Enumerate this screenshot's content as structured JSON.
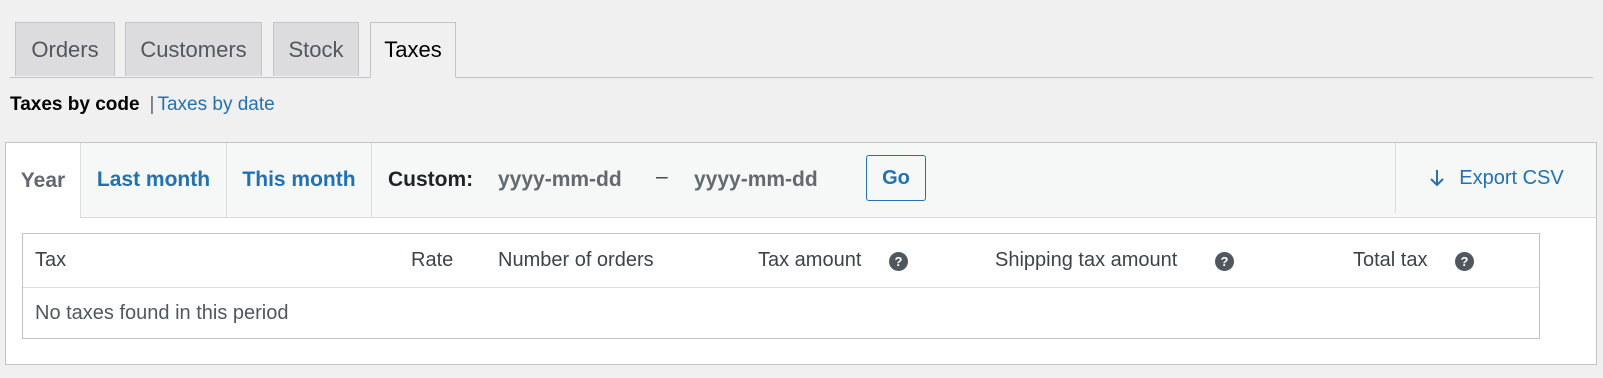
{
  "tabs": [
    "Orders",
    "Customers",
    "Stock",
    "Taxes"
  ],
  "active_tab": "Taxes",
  "subnav": {
    "current": "Taxes by code",
    "separator": "|",
    "link": "Taxes by date"
  },
  "range": {
    "tabs": [
      "Year",
      "Last month",
      "This month"
    ],
    "active": "Year",
    "custom_label": "Custom:",
    "start_placeholder": "yyyy-mm-dd",
    "end_placeholder": "yyyy-mm-dd",
    "dash": "–",
    "go_label": "Go",
    "export_label": "Export CSV",
    "export_icon": "arrow-down-icon"
  },
  "table": {
    "columns": [
      "Tax",
      "Rate",
      "Number of orders",
      "Tax amount",
      "Shipping tax amount",
      "Total tax"
    ],
    "help_columns": [
      "Tax amount",
      "Shipping tax amount",
      "Total tax"
    ],
    "help_icon": "question-mark-icon",
    "empty_message": "No taxes found in this period"
  },
  "colors": {
    "accent": "#2271b1",
    "background": "#f0f0f1",
    "tab_inactive": "#dcdcde",
    "help_icon": "#50575e"
  }
}
